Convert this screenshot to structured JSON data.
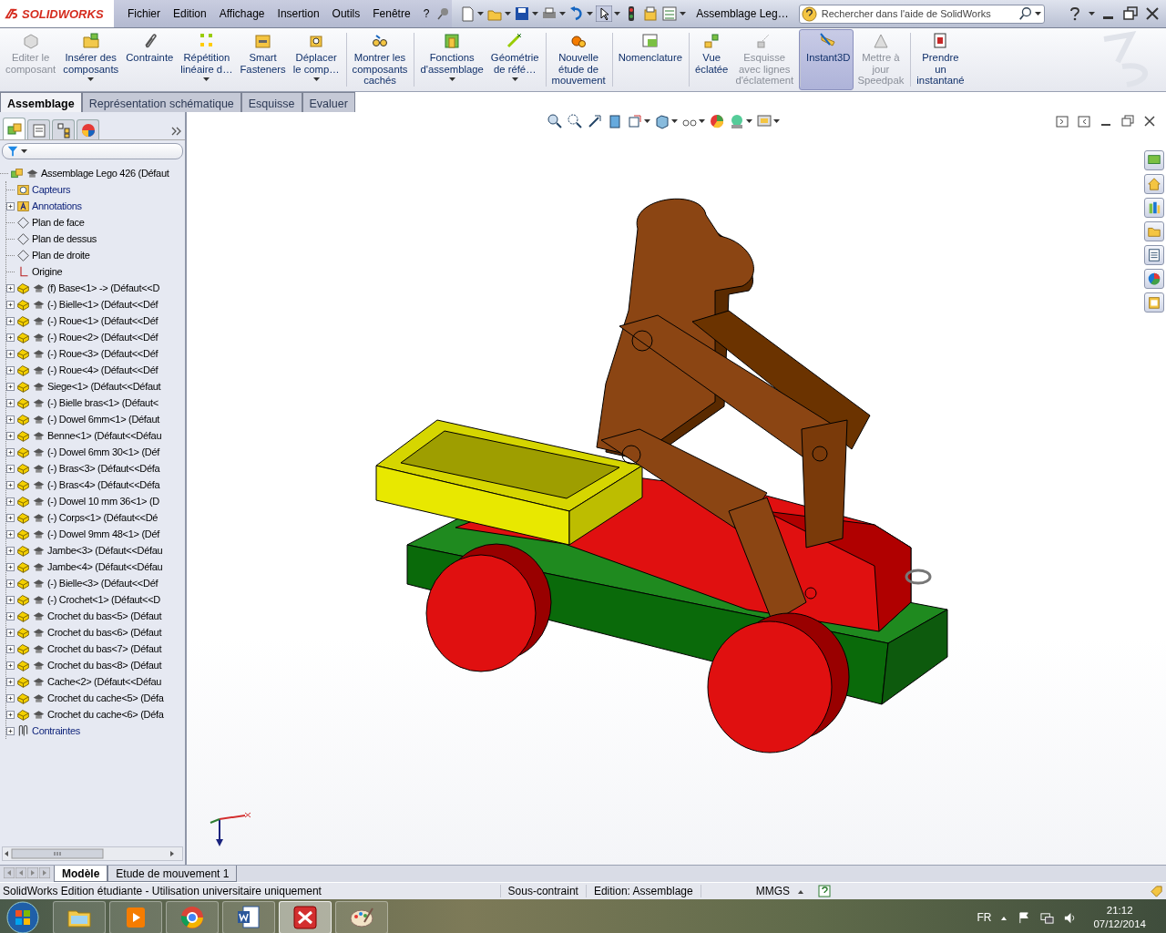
{
  "logo": "SOLIDWORKS",
  "menu": [
    "Fichier",
    "Edition",
    "Affichage",
    "Insertion",
    "Outils",
    "Fenêtre",
    "?"
  ],
  "document_title": "Assemblage Leg…",
  "search": {
    "placeholder": "Rechercher dans l'aide de SolidWorks"
  },
  "ribbon": [
    {
      "label": "Editer le\ncomposant",
      "disabled": true,
      "on": false,
      "dropdown": false,
      "separator_before": false
    },
    {
      "label": "Insérer des\ncomposants",
      "disabled": false,
      "on": false,
      "dropdown": true,
      "separator_before": false
    },
    {
      "label": "Contrainte",
      "disabled": false,
      "on": false,
      "dropdown": false,
      "separator_before": false
    },
    {
      "label": "Répétition\nlinéaire d…",
      "disabled": false,
      "on": false,
      "dropdown": true,
      "separator_before": false
    },
    {
      "label": "Smart\nFasteners",
      "disabled": false,
      "on": false,
      "dropdown": false,
      "separator_before": false
    },
    {
      "label": "Déplacer\nle comp…",
      "disabled": false,
      "on": false,
      "dropdown": true,
      "separator_before": false
    },
    {
      "label": "Montrer les\ncomposants\ncachés",
      "disabled": false,
      "on": false,
      "dropdown": false,
      "separator_before": true
    },
    {
      "label": "Fonctions\nd'assemblage",
      "disabled": false,
      "on": false,
      "dropdown": true,
      "separator_before": true
    },
    {
      "label": "Géométrie\nde réfé…",
      "disabled": false,
      "on": false,
      "dropdown": true,
      "separator_before": false
    },
    {
      "label": "Nouvelle\nétude de\nmouvement",
      "disabled": false,
      "on": false,
      "dropdown": false,
      "separator_before": true
    },
    {
      "label": "Nomenclature",
      "disabled": false,
      "on": false,
      "dropdown": false,
      "separator_before": true
    },
    {
      "label": "Vue\néclatée",
      "disabled": false,
      "on": false,
      "dropdown": false,
      "separator_before": true
    },
    {
      "label": "Esquisse\navec lignes\nd'éclatement",
      "disabled": true,
      "on": false,
      "dropdown": false,
      "separator_before": false
    },
    {
      "label": "Instant3D",
      "disabled": false,
      "on": true,
      "dropdown": false,
      "separator_before": true
    },
    {
      "label": "Mettre à\njour\nSpeedpak",
      "disabled": true,
      "on": false,
      "dropdown": false,
      "separator_before": false
    },
    {
      "label": "Prendre\nun\ninstantané",
      "disabled": false,
      "on": false,
      "dropdown": false,
      "separator_before": true
    }
  ],
  "command_tabs": [
    {
      "label": "Assemblage",
      "selected": true
    },
    {
      "label": "Représentation schématique",
      "selected": false
    },
    {
      "label": "Esquisse",
      "selected": false
    },
    {
      "label": "Evaluer",
      "selected": false
    }
  ],
  "panel_tabs": [
    {
      "selected": true
    },
    {
      "selected": false
    },
    {
      "selected": false
    },
    {
      "selected": false
    }
  ],
  "tree": {
    "label": "Assemblage Lego 426  (Défaut",
    "kind": "assembly",
    "children": [
      {
        "label": "Capteurs",
        "kind": "sensors",
        "expandable": false
      },
      {
        "label": "Annotations",
        "kind": "annotations",
        "expandable": true
      },
      {
        "label": "Plan de face",
        "kind": "plane",
        "expandable": false
      },
      {
        "label": "Plan de dessus",
        "kind": "plane",
        "expandable": false
      },
      {
        "label": "Plan de droite",
        "kind": "plane",
        "expandable": false
      },
      {
        "label": "Origine",
        "kind": "origin",
        "expandable": false
      },
      {
        "label": "(f) Base<1> -> (Défaut<<D",
        "kind": "part",
        "expandable": true
      },
      {
        "label": "(-) Bielle<1> (Défaut<<Déf",
        "kind": "part",
        "expandable": true
      },
      {
        "label": "(-) Roue<1> (Défaut<<Déf",
        "kind": "part",
        "expandable": true
      },
      {
        "label": "(-) Roue<2> (Défaut<<Déf",
        "kind": "part",
        "expandable": true
      },
      {
        "label": "(-) Roue<3> (Défaut<<Déf",
        "kind": "part",
        "expandable": true
      },
      {
        "label": "(-) Roue<4> (Défaut<<Déf",
        "kind": "part",
        "expandable": true
      },
      {
        "label": "Siege<1> (Défaut<<Défaut",
        "kind": "part",
        "expandable": true
      },
      {
        "label": "(-) Bielle bras<1> (Défaut<",
        "kind": "part",
        "expandable": true
      },
      {
        "label": "(-) Dowel 6mm<1> (Défaut",
        "kind": "part",
        "expandable": true
      },
      {
        "label": "Benne<1> (Défaut<<Défau",
        "kind": "part",
        "expandable": true
      },
      {
        "label": "(-) Dowel 6mm 30<1> (Déf",
        "kind": "part",
        "expandable": true
      },
      {
        "label": "(-) Bras<3> (Défaut<<Défa",
        "kind": "part",
        "expandable": true
      },
      {
        "label": "(-) Bras<4> (Défaut<<Défa",
        "kind": "part",
        "expandable": true
      },
      {
        "label": "(-) Dowel 10 mm 36<1> (D",
        "kind": "part",
        "expandable": true
      },
      {
        "label": "(-) Corps<1> (Défaut<<Dé",
        "kind": "part",
        "expandable": true
      },
      {
        "label": "(-) Dowel 9mm 48<1> (Déf",
        "kind": "part",
        "expandable": true
      },
      {
        "label": "Jambe<3> (Défaut<<Défau",
        "kind": "part",
        "expandable": true
      },
      {
        "label": "Jambe<4> (Défaut<<Défau",
        "kind": "part",
        "expandable": true
      },
      {
        "label": "(-) Bielle<3> (Défaut<<Déf",
        "kind": "part",
        "expandable": true
      },
      {
        "label": "(-) Crochet<1> (Défaut<<D",
        "kind": "part",
        "expandable": true
      },
      {
        "label": "Crochet du bas<5> (Défaut",
        "kind": "part",
        "expandable": true
      },
      {
        "label": "Crochet du bas<6> (Défaut",
        "kind": "part",
        "expandable": true
      },
      {
        "label": "Crochet du bas<7> (Défaut",
        "kind": "part",
        "expandable": true
      },
      {
        "label": "Crochet du bas<8> (Défaut",
        "kind": "part",
        "expandable": true
      },
      {
        "label": "Cache<2> (Défaut<<Défau",
        "kind": "part",
        "expandable": true
      },
      {
        "label": "Crochet du cache<5> (Défa",
        "kind": "part",
        "expandable": true
      },
      {
        "label": "Crochet du cache<6> (Défa",
        "kind": "part",
        "expandable": true
      },
      {
        "label": "Contraintes",
        "kind": "mates",
        "expandable": true
      }
    ]
  },
  "bottom_tabs": [
    {
      "label": "Modèle",
      "selected": true
    },
    {
      "label": "Etude de mouvement 1",
      "selected": false
    }
  ],
  "status_bar": {
    "message": "SolidWorks Edition étudiante - Utilisation universitaire uniquement",
    "constraint": "Sous-contraint",
    "mode": "Edition: Assemblage",
    "units": "MMGS"
  },
  "taskbar": {
    "apps": [
      {
        "selected": false
      },
      {
        "selected": false
      },
      {
        "selected": false
      },
      {
        "selected": false
      },
      {
        "selected": true
      },
      {
        "selected": false
      }
    ],
    "language": "FR",
    "time": "21:12",
    "date": "07/12/2014"
  }
}
